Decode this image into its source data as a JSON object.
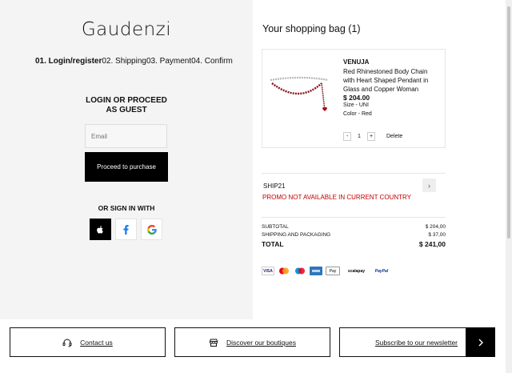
{
  "brand": {
    "logo": "Gaudenzi"
  },
  "checkout_steps": [
    {
      "label": "01. Login/register",
      "active": true
    },
    {
      "label": "02. Shipping",
      "active": false
    },
    {
      "label": "03. Payment",
      "active": false
    },
    {
      "label": "04. Confirm",
      "active": false
    }
  ],
  "login": {
    "title_line1": "LOGIN OR PROCEED",
    "title_line2": "AS GUEST",
    "email_placeholder": "Email",
    "proceed_label": "Proceed to purchase",
    "or_sign_in": "OR SIGN IN WITH",
    "social": [
      "apple-icon",
      "facebook-icon",
      "google-icon"
    ]
  },
  "bag": {
    "title": "Your shopping bag (1)",
    "item": {
      "brand": "VENUJA",
      "name": "Red Rhinestoned Body Chain with Heart Shaped Pendant in Glass and Copper Woman",
      "price": "$ 204.00",
      "size": "Size - UNI",
      "color": "Color - Red",
      "qty_minus": "-",
      "quantity": "1",
      "qty_plus": "+",
      "delete_label": "Delete"
    },
    "promo": {
      "code": "SHIP21",
      "error": "PROMO NOT AVAILABLE IN CURRENT COUNTRY"
    },
    "summary": {
      "subtotal_label": "SUBTOTAL",
      "subtotal_value": "$ 204,00",
      "shipping_label": "SHIPPING AND PACKAGING",
      "shipping_value": "$ 37,00",
      "total_label": "TOTAL",
      "total_value": "$ 241,00"
    },
    "payments": {
      "visa": "VISA",
      "applepay": "Pay",
      "scalapay": "scalapay",
      "paypal": "PayPal"
    }
  },
  "footer": {
    "contact": "Contact us",
    "boutiques": "Discover our boutiques",
    "newsletter": "Subscribe to our newsletter"
  },
  "colors": {
    "error": "#c20000",
    "left_bg": "#f4f4f4",
    "black": "#000000"
  }
}
